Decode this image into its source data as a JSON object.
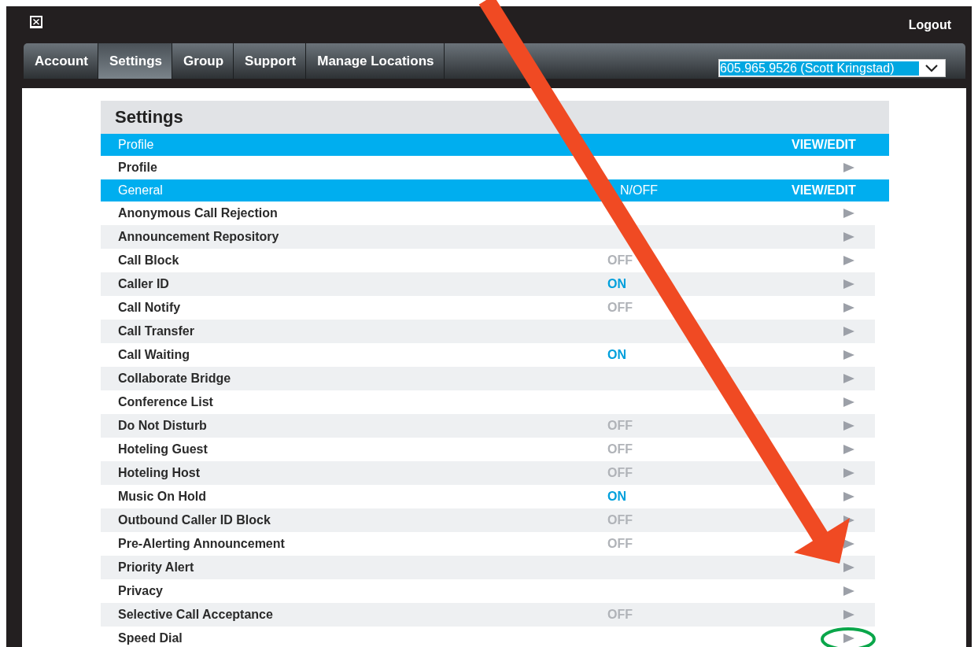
{
  "top_bar": {
    "logout": "Logout"
  },
  "tabs": [
    {
      "label": "Account",
      "selected": false
    },
    {
      "label": "Settings",
      "selected": true
    },
    {
      "label": "Group",
      "selected": false
    },
    {
      "label": "Support",
      "selected": false
    },
    {
      "label": "Manage Locations",
      "selected": false
    }
  ],
  "account_select": {
    "value": "605.965.9526 (Scott Kringstad)"
  },
  "settings": {
    "title": "Settings",
    "sections": [
      {
        "title": "Profile",
        "action_heading": "VIEW/EDIT",
        "rows": [
          {
            "label": "Profile"
          }
        ]
      },
      {
        "title": "General",
        "status_heading": "N/OFF",
        "action_heading": "VIEW/EDIT",
        "rows": [
          {
            "label": "Anonymous Call Rejection"
          },
          {
            "label": "Announcement Repository"
          },
          {
            "label": "Call Block",
            "status": "OFF",
            "on": false
          },
          {
            "label": "Caller ID",
            "status": "ON",
            "on": true
          },
          {
            "label": "Call Notify",
            "status": "OFF",
            "on": false
          },
          {
            "label": "Call Transfer"
          },
          {
            "label": "Call Waiting",
            "status": "ON",
            "on": true
          },
          {
            "label": "Collaborate Bridge"
          },
          {
            "label": "Conference List"
          },
          {
            "label": "Do Not Disturb",
            "status": "OFF",
            "on": false
          },
          {
            "label": "Hoteling Guest",
            "status": "OFF",
            "on": false
          },
          {
            "label": "Hoteling Host",
            "status": "OFF",
            "on": false
          },
          {
            "label": "Music On Hold",
            "status": "ON",
            "on": true
          },
          {
            "label": "Outbound Caller ID Block",
            "status": "OFF",
            "on": false
          },
          {
            "label": "Pre-Alerting Announcement",
            "status": "OFF",
            "on": false
          },
          {
            "label": "Priority Alert"
          },
          {
            "label": "Privacy"
          },
          {
            "label": "Selective Call Acceptance",
            "status": "OFF",
            "on": false
          },
          {
            "label": "Speed Dial"
          }
        ]
      }
    ]
  }
}
